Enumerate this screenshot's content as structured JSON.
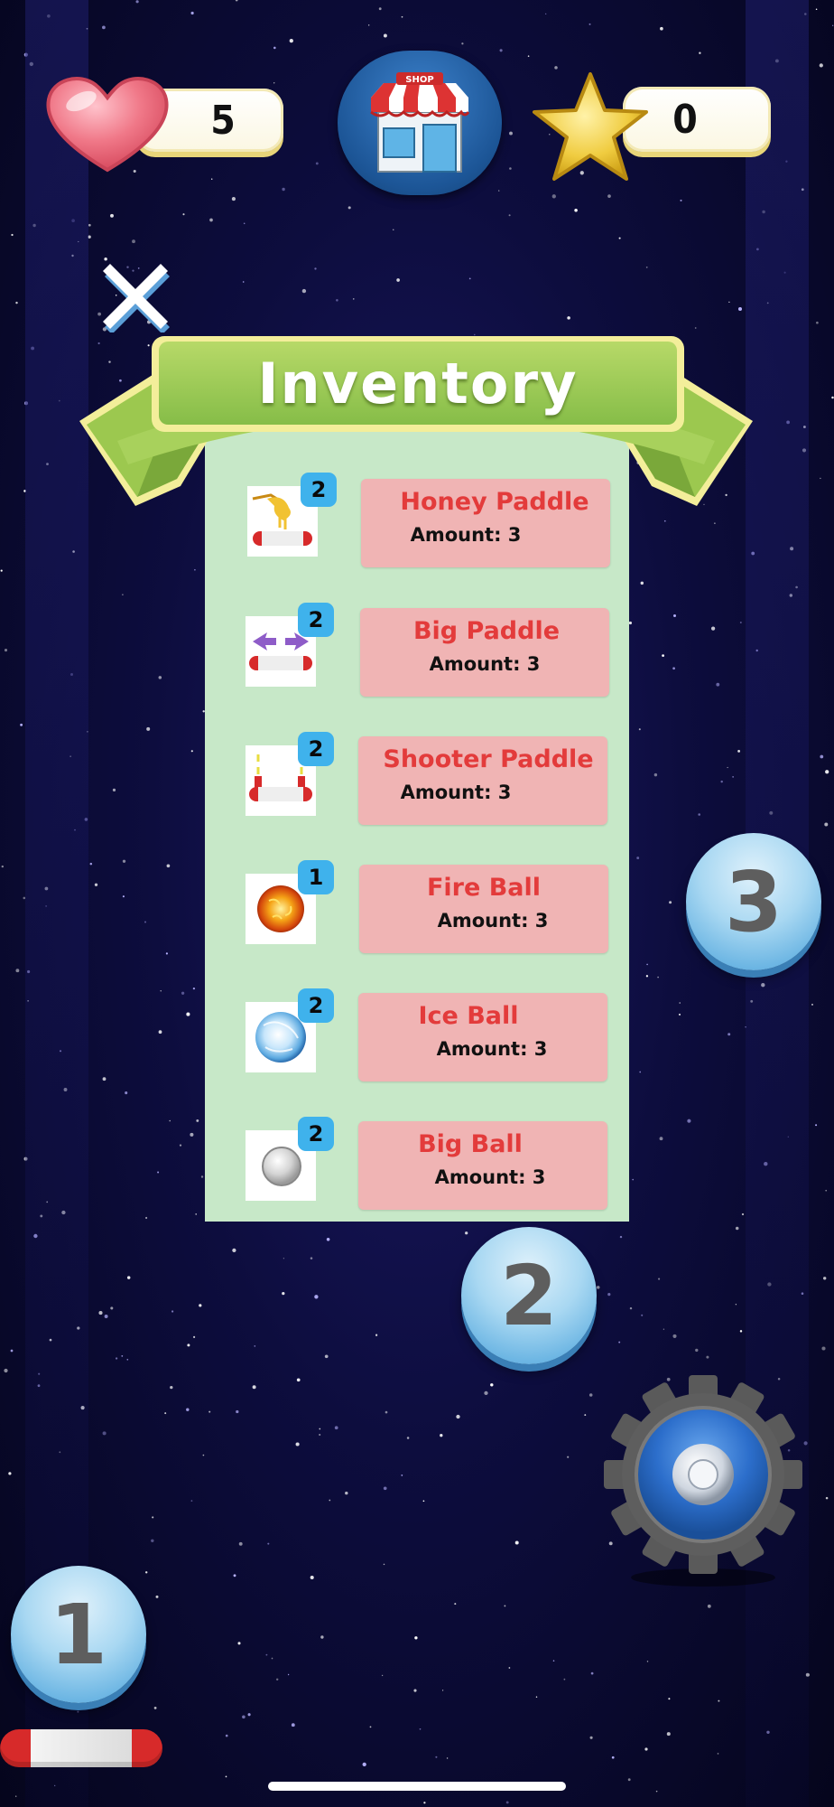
{
  "hud": {
    "lives": "5",
    "stars": "0",
    "shop_sign": "SHOP"
  },
  "inventory": {
    "title": "Inventory",
    "items": [
      {
        "name": "Honey Paddle",
        "amount": "Amount: 3",
        "count": "2",
        "icon": "honey-paddle-icon"
      },
      {
        "name": "Big Paddle",
        "amount": "Amount: 3",
        "count": "2",
        "icon": "big-paddle-icon"
      },
      {
        "name": "Shooter Paddle",
        "amount": "Amount: 3",
        "count": "2",
        "icon": "shooter-paddle-icon"
      },
      {
        "name": "Fire Ball",
        "amount": "Amount: 3",
        "count": "1",
        "icon": "fire-ball-icon"
      },
      {
        "name": "Ice Ball",
        "amount": "Amount: 3",
        "count": "2",
        "icon": "ice-ball-icon"
      },
      {
        "name": "Big Ball",
        "amount": "Amount: 3",
        "count": "2",
        "icon": "big-ball-icon"
      }
    ]
  },
  "level_balls": [
    "3",
    "2",
    "1"
  ],
  "colors": {
    "background": "#0d0d3e",
    "panel": "#c7e8c8",
    "banner_green": "#8cc04a",
    "card": "#f0b4b4",
    "item_name": "#e33b3b",
    "badge": "#3fb2ec"
  }
}
